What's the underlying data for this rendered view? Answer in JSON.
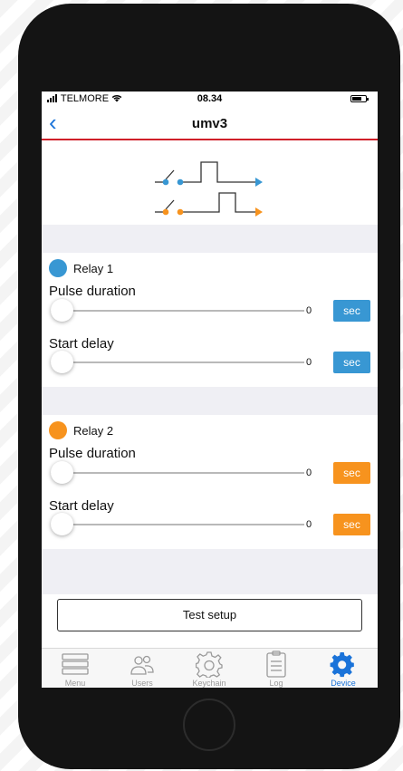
{
  "status_bar": {
    "carrier": "TELMORE",
    "time": "08.34"
  },
  "nav": {
    "back_icon": "chevron-left-icon",
    "title": "umv3"
  },
  "colors": {
    "relay1": "#3897d3",
    "relay2": "#f7931e",
    "accent": "#1a73d9",
    "nav_underline": "#d0202a"
  },
  "relays": [
    {
      "name": "Relay 1",
      "pulse_label": "Pulse duration",
      "pulse_value": "0",
      "pulse_level": 0,
      "pulse_unit": "sec",
      "delay_label": "Start delay",
      "delay_value": "0",
      "delay_level": 0,
      "delay_unit": "sec"
    },
    {
      "name": "Relay 2",
      "pulse_label": "Pulse duration",
      "pulse_value": "0",
      "pulse_level": 0,
      "pulse_unit": "sec",
      "delay_label": "Start delay",
      "delay_value": "0",
      "delay_level": 0,
      "delay_unit": "sec"
    }
  ],
  "test_button": "Test setup",
  "tabs": [
    {
      "label": "Menu",
      "icon": "menu-icon",
      "active": false
    },
    {
      "label": "Users",
      "icon": "users-icon",
      "active": false
    },
    {
      "label": "Keychain",
      "icon": "gear-outline-icon",
      "active": false
    },
    {
      "label": "Log",
      "icon": "clipboard-icon",
      "active": false
    },
    {
      "label": "Device",
      "icon": "gear-icon",
      "active": true
    }
  ]
}
